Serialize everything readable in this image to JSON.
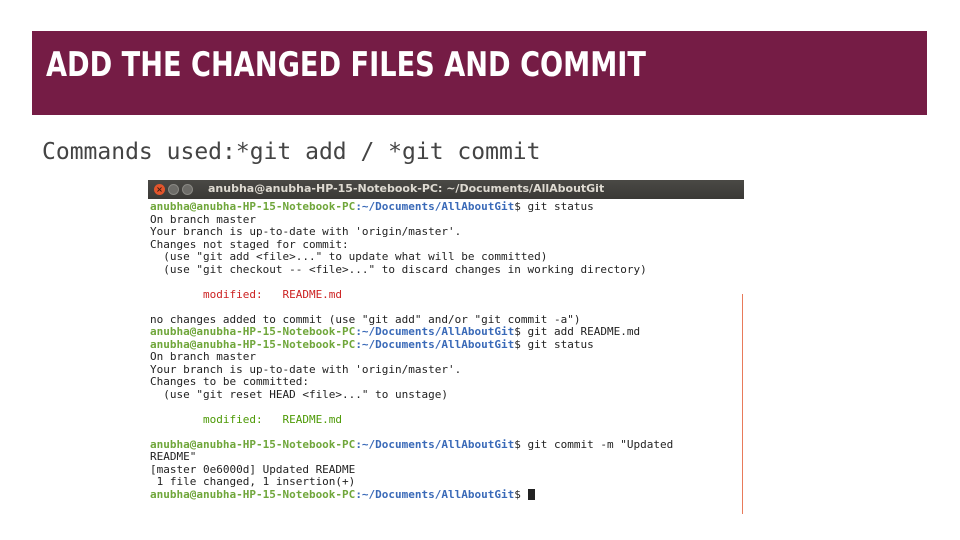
{
  "slide": {
    "title": "Add the changed files and commit",
    "subtitle": "Commands used:*git add / *git commit"
  },
  "terminal": {
    "window_title": "anubha@anubha-HP-15-Notebook-PC: ~/Documents/AllAboutGit",
    "close_glyph": "×",
    "prompt_user": "anubha@anubha-HP-15-Notebook-PC",
    "prompt_path": ":~/Documents/AllAboutGit",
    "lines": {
      "cmd1": "$ git status",
      "l2": "On branch master",
      "l3": "Your branch is up-to-date with 'origin/master'.",
      "l4": "Changes not staged for commit:",
      "l5": "  (use \"git add <file>...\" to update what will be committed)",
      "l6": "  (use \"git checkout -- <file>...\" to discard changes in working directory)",
      "l7": "        modified:   README.md",
      "l8": "no changes added to commit (use \"git add\" and/or \"git commit -a\")",
      "cmd2": "$ git add README.md",
      "cmd3": "$ git status",
      "l11": "On branch master",
      "l12": "Your branch is up-to-date with 'origin/master'.",
      "l13": "Changes to be committed:",
      "l14": "  (use \"git reset HEAD <file>...\" to unstage)",
      "l15": "        modified:   README.md",
      "cmd4": "$ git commit -m \"Updated",
      "l17": "README\"",
      "l18": "[master 0e6000d] Updated README",
      "l19": " 1 file changed, 1 insertion(+)",
      "cmd5": "$ "
    }
  },
  "colors": {
    "title_bar": "#751c45",
    "prompt_user": "#6fa63a",
    "prompt_path": "#3a6ab8",
    "unstaged": "#cc2222",
    "staged": "#4d9a06"
  }
}
